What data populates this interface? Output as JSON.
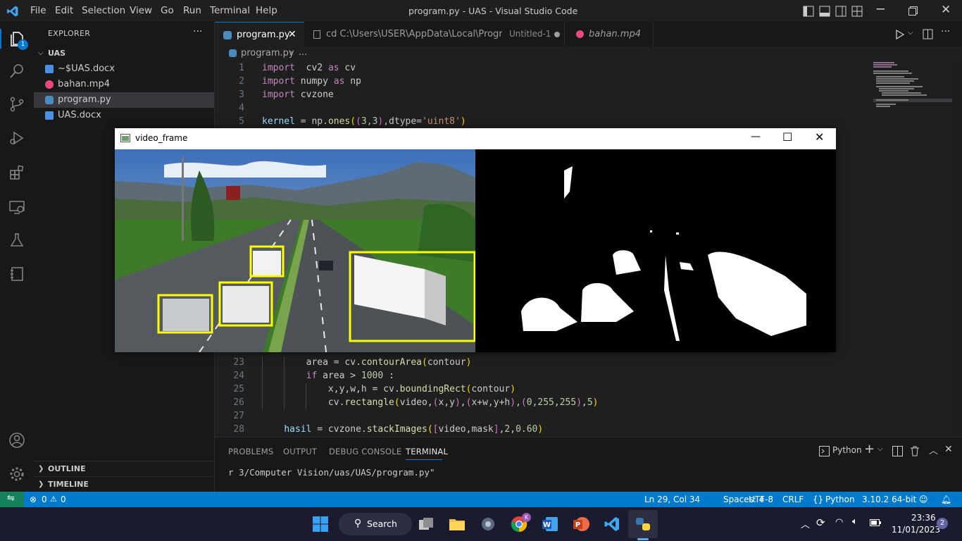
{
  "titlebar": {
    "menu": [
      "File",
      "Edit",
      "Selection",
      "View",
      "Go",
      "Run",
      "Terminal",
      "Help"
    ],
    "window_title": "program.py - UAS - Visual Studio Code"
  },
  "activity_bar": {
    "explorer_badge": "1",
    "icons": [
      "files-icon",
      "search-icon",
      "source-control-icon",
      "run-debug-icon",
      "extensions-icon",
      "remote-explorer-icon",
      "testing-icon",
      "notebook-icon",
      "account-icon",
      "settings-gear-icon"
    ]
  },
  "sidebar": {
    "title": "EXPLORER",
    "more": "···",
    "folder": "UAS",
    "files": [
      {
        "name": "~$UAS.docx",
        "icon": "word-icon",
        "color": "#4a90e2"
      },
      {
        "name": "bahan.mp4",
        "icon": "video-file-icon",
        "color": "#e84a7f"
      },
      {
        "name": "program.py",
        "icon": "python-file-icon",
        "color": "#4b8bbe"
      },
      {
        "name": "UAS.docx",
        "icon": "word-icon",
        "color": "#4a90e2"
      }
    ],
    "outline": "OUTLINE",
    "timeline": "TIMELINE"
  },
  "tabs": [
    {
      "label": "program.py",
      "active": true
    },
    {
      "label": "cd C:\\Users\\USER\\AppData\\Local\\Programs\\",
      "sublabel": "Untitled-1"
    },
    {
      "label": "bahan.mp4"
    }
  ],
  "breadcrumb": {
    "file": "program.py",
    "more": "..."
  },
  "code_top": [
    {
      "n": "1",
      "segs": [
        [
          "kw",
          "import"
        ],
        [
          "",
          "  cv2 "
        ],
        [
          "kw",
          "as"
        ],
        [
          "",
          " cv"
        ]
      ]
    },
    {
      "n": "2",
      "segs": [
        [
          "kw",
          "import"
        ],
        [
          "",
          " numpy "
        ],
        [
          "kw",
          "as"
        ],
        [
          "",
          " np"
        ]
      ]
    },
    {
      "n": "3",
      "segs": [
        [
          "kw",
          "import"
        ],
        [
          "",
          " cvzone"
        ]
      ]
    },
    {
      "n": "4",
      "segs": []
    },
    {
      "n": "5",
      "segs": [
        [
          "vr",
          "kernel"
        ],
        [
          "",
          " = np."
        ],
        [
          "fn",
          "ones"
        ],
        [
          "bk",
          "("
        ],
        [
          "bk2",
          "("
        ],
        [
          "nm",
          "3"
        ],
        [
          "",
          ","
        ],
        [
          "nm",
          "3"
        ],
        [
          "bk2",
          ")"
        ],
        [
          "",
          ",dtype="
        ],
        [
          "st",
          "'uint8'"
        ],
        [
          "bk",
          ")"
        ]
      ]
    }
  ],
  "code_bottom": [
    {
      "n": "23",
      "segs": [
        [
          "",
          "        area = cv."
        ],
        [
          "fn",
          "contourArea"
        ],
        [
          "bk",
          "("
        ],
        [
          "",
          "contour"
        ],
        [
          "bk",
          ")"
        ]
      ]
    },
    {
      "n": "24",
      "segs": [
        [
          "",
          "        "
        ],
        [
          "kw",
          "if"
        ],
        [
          "",
          " area > "
        ],
        [
          "nm",
          "1000"
        ],
        [
          "",
          " :"
        ]
      ]
    },
    {
      "n": "25",
      "segs": [
        [
          "",
          "            x,y,w,h = cv."
        ],
        [
          "fn",
          "boundingRect"
        ],
        [
          "bk",
          "("
        ],
        [
          "",
          "contour"
        ],
        [
          "bk",
          ")"
        ]
      ]
    },
    {
      "n": "26",
      "segs": [
        [
          "",
          "            cv."
        ],
        [
          "fn",
          "rectangle"
        ],
        [
          "bk",
          "("
        ],
        [
          "",
          "video,"
        ],
        [
          "bk2",
          "("
        ],
        [
          "",
          "x,y"
        ],
        [
          "bk2",
          ")"
        ],
        [
          "",
          ","
        ],
        [
          "bk2",
          "("
        ],
        [
          "",
          "x+w,y+h"
        ],
        [
          "bk2",
          ")"
        ],
        [
          "",
          ","
        ],
        [
          "bk2",
          "("
        ],
        [
          "nm",
          "0"
        ],
        [
          "",
          ","
        ],
        [
          "nm",
          "255"
        ],
        [
          "",
          ","
        ],
        [
          "nm",
          "255"
        ],
        [
          "bk2",
          ")"
        ],
        [
          "",
          ","
        ],
        [
          "nm",
          "5"
        ],
        [
          "bk",
          ")"
        ]
      ]
    },
    {
      "n": "27",
      "segs": []
    },
    {
      "n": "28",
      "segs": [
        [
          "",
          "    "
        ],
        [
          "vr",
          "hasil"
        ],
        [
          "",
          " = cvzone."
        ],
        [
          "fn",
          "stackImages"
        ],
        [
          "bk",
          "("
        ],
        [
          "bk2",
          "["
        ],
        [
          "",
          "video,mask"
        ],
        [
          "bk2",
          "]"
        ],
        [
          "",
          ","
        ],
        [
          "nm",
          "2"
        ],
        [
          "",
          ","
        ],
        [
          "nm",
          "0.60"
        ],
        [
          "bk",
          ")"
        ]
      ]
    }
  ],
  "cv_window": {
    "title": "video_frame",
    "minimize": "—",
    "maximize": "☐",
    "close": "✕"
  },
  "panel": {
    "tabs": [
      "PROBLEMS",
      "OUTPUT",
      "DEBUG CONSOLE",
      "TERMINAL"
    ],
    "active_tab": "TERMINAL",
    "terminal_profile": "Python",
    "terminal_text": "r 3/Computer Vision/uas/UAS/program.py\""
  },
  "statusbar": {
    "errors": "0",
    "warnings": "0",
    "position": "Ln 29, Col 34",
    "spaces": "Spaces: 4",
    "encoding": "UTF-8",
    "eol": "CRLF",
    "language": "Python",
    "interpreter": "3.10.2 64-bit"
  },
  "taskbar": {
    "search": "Search",
    "time": "23:36",
    "date": "11/01/2023",
    "notifications": "2",
    "chrome_badge": "K"
  }
}
